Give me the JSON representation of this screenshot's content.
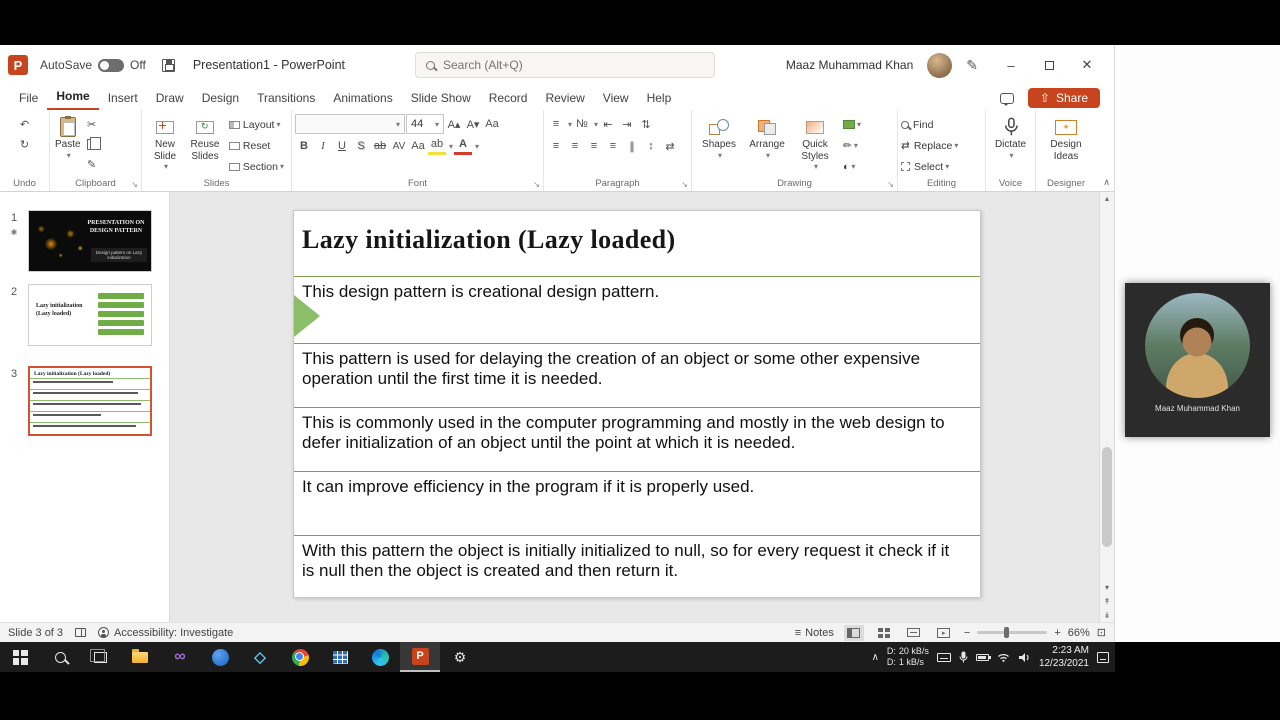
{
  "icons": {
    "pp_logo": "P",
    "dropdown": "▾",
    "undo": "↶",
    "redo": "↻",
    "reuse_arrow": "↻",
    "cut": "✂",
    "format_painter": "✎",
    "grow_font": "A▴",
    "shrink_font": "A▾",
    "clear_format": "Aa",
    "bold": "B",
    "italic": "I",
    "underline": "U",
    "shadow": "S",
    "strikethrough": "ab",
    "char_spacing": "AV",
    "change_case": "Aa",
    "highlight": "ab",
    "font_color": "A",
    "bullets": "≡",
    "numbering": "№",
    "indent_dec": "⇤",
    "indent_inc": "⇥",
    "text_direction": "⇅",
    "align": "≡",
    "columns": "∥",
    "line_spacing": "↕",
    "smartart": "⇄",
    "replace": "⇄",
    "shape_outline": "✏",
    "shape_effects": "◐",
    "share_arrow": "⇧",
    "pen": "✎",
    "minimize": "–",
    "close": "✕",
    "scroll_up": "▴",
    "scroll_down": "▾",
    "prev_slide": "↟",
    "next_slide": "↡",
    "animation_star": "✱",
    "sparkle": "✦",
    "vs_logo": "∞",
    "viewer_3d": "◇",
    "gear": "⚙",
    "tray_chevron": "∧",
    "zoom_out": "−",
    "zoom_in": "+",
    "fit_window": "⊡",
    "notes": "≡",
    "slideshow_play": "▸",
    "launcher": "↘",
    "collapse": "∧"
  },
  "titlebar": {
    "autosave_label": "AutoSave",
    "autosave_state": "Off",
    "title": "Presentation1 - PowerPoint",
    "search_placeholder": "Search (Alt+Q)",
    "user_name": "Maaz Muhammad Khan"
  },
  "tabs": {
    "items": [
      "File",
      "Home",
      "Insert",
      "Draw",
      "Design",
      "Transitions",
      "Animations",
      "Slide Show",
      "Record",
      "Review",
      "View",
      "Help"
    ],
    "active": "Home",
    "share": "Share"
  },
  "ribbon": {
    "font_size": "44",
    "groups": {
      "undo": "Undo",
      "clipboard": "Clipboard",
      "slides": "Slides",
      "font": "Font",
      "paragraph": "Paragraph",
      "drawing": "Drawing",
      "editing": "Editing",
      "voice": "Voice",
      "designer": "Designer"
    },
    "buttons": {
      "paste": "Paste",
      "new_slide": "New Slide",
      "reuse_slides": "Reuse Slides",
      "layout": "Layout",
      "reset": "Reset",
      "section": "Section",
      "shapes": "Shapes",
      "arrange": "Arrange",
      "quick_styles": "Quick Styles",
      "find": "Find",
      "replace": "Replace",
      "select": "Select",
      "dictate": "Dictate",
      "design_ideas": "Design Ideas"
    }
  },
  "thumbnails": [
    {
      "number": "1",
      "title": "PRESENTATION ON DESIGN PATTERN",
      "caption": "Design pattern on Lazy initialization"
    },
    {
      "number": "2",
      "title": "Lazy initialization (Lazy loaded)"
    },
    {
      "number": "3",
      "title": "Lazy initialization (Lazy loaded)"
    }
  ],
  "slide": {
    "title": "Lazy initialization (Lazy loaded)",
    "rows": [
      "This design pattern is creational design pattern.",
      "This pattern is used for delaying the creation of an object or some other expensive operation until the first time it is needed.",
      "This is commonly used in the computer programming and mostly in the web design to defer initialization of an object until the point at which it is needed.",
      "It can improve efficiency in the program if it is properly used.",
      "With this pattern the object is initially initialized to null, so for every request it check if it is null then the object is created and then return it."
    ],
    "accent_green": "#7ca04c",
    "triangle_green": "#8cbe6a"
  },
  "webcam": {
    "name": "Maaz Muhammad Khan"
  },
  "statusbar": {
    "slide_indicator": "Slide 3 of 3",
    "accessibility": "Accessibility: Investigate",
    "notes": "Notes",
    "zoom": "66%"
  },
  "taskbar": {
    "net_label": "D:",
    "net_up": "20 kB/s",
    "net_down": "1 kB/s",
    "time": "2:23 AM",
    "date": "12/23/2021"
  }
}
